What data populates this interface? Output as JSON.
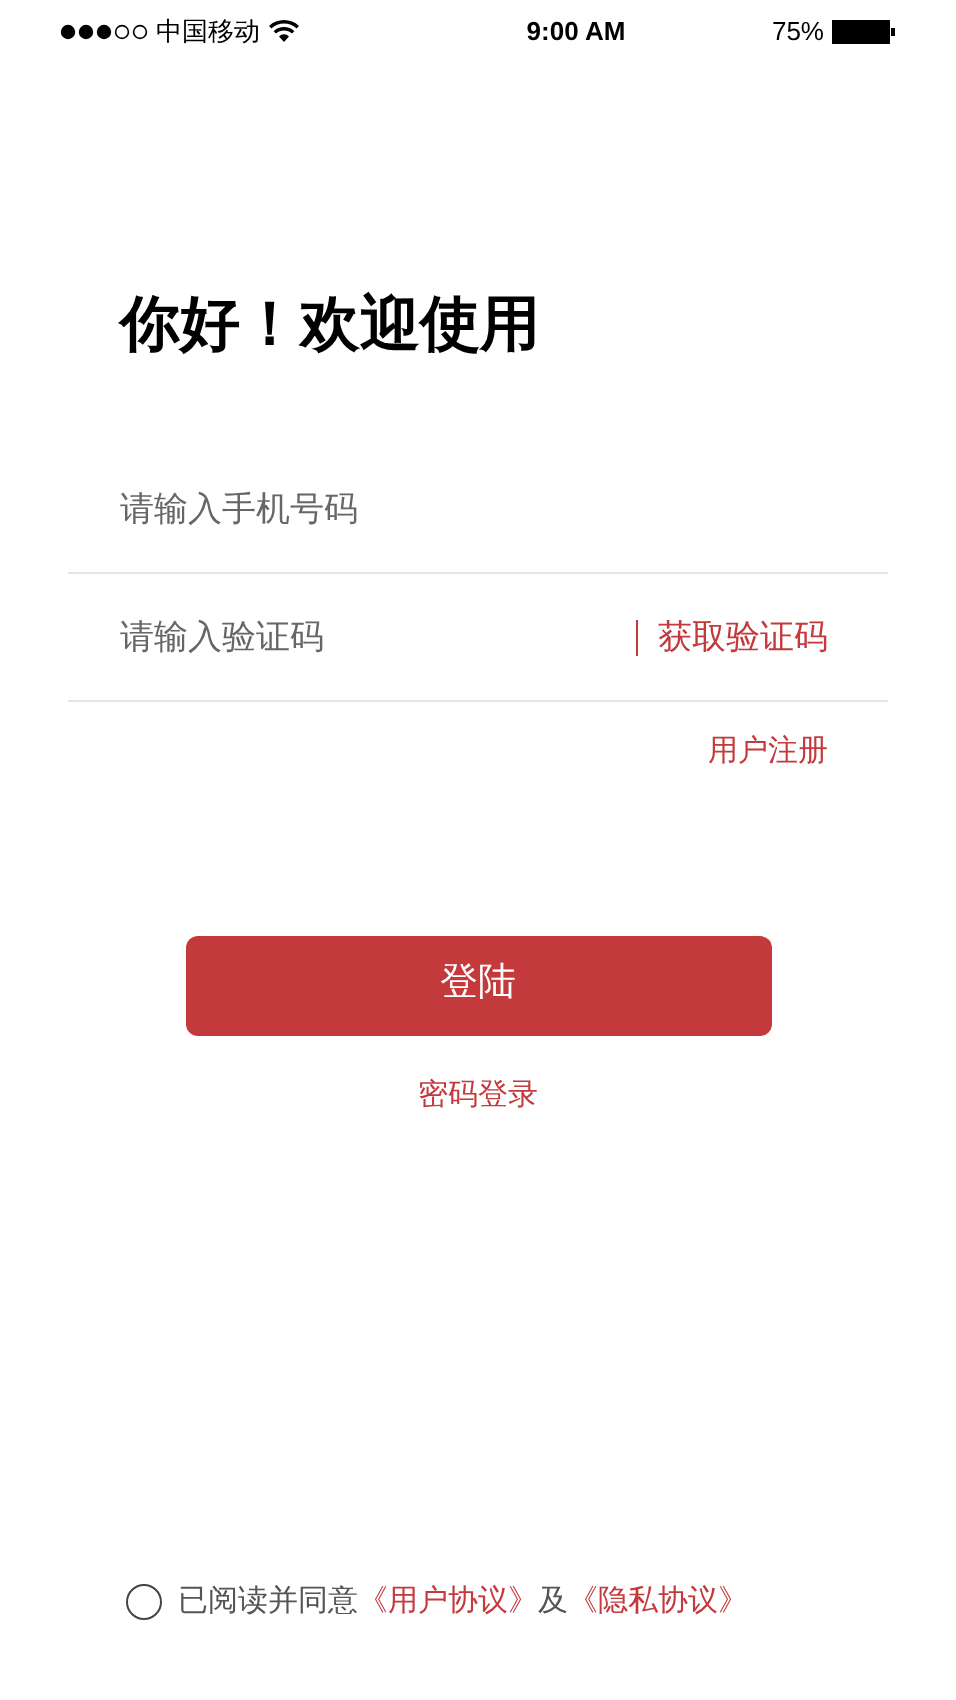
{
  "status_bar": {
    "carrier": "中国移动",
    "time": "9:00 AM",
    "battery": "75%"
  },
  "title": "你好！欢迎使用",
  "phone_field": {
    "placeholder": "请输入手机号码"
  },
  "code_field": {
    "placeholder": "请输入验证码"
  },
  "get_code": "获取验证码",
  "register": "用户注册",
  "login_button": "登陆",
  "password_login": "密码登录",
  "agreement": {
    "checked": false,
    "text": "已阅读并同意",
    "link_1": "《用户协议》",
    "connector": "及",
    "link_2": "《隐私协议》"
  }
}
